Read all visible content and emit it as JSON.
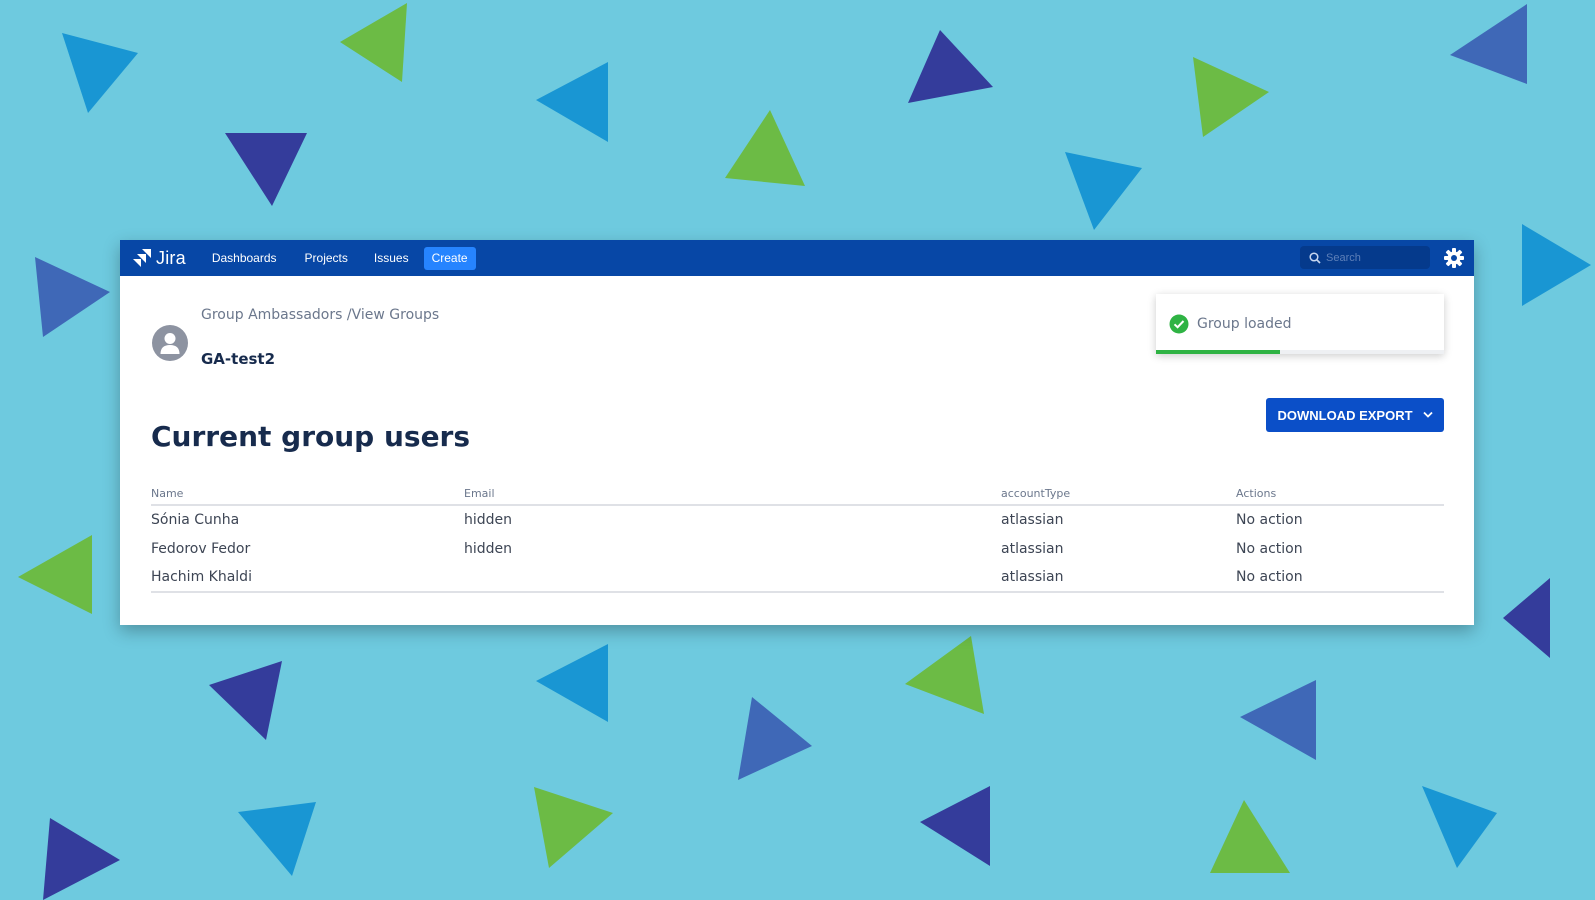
{
  "background": {
    "color": "#6ecadf",
    "triangle_colors": [
      "#1996d3",
      "#6cbb45",
      "#343c9b",
      "#3f68b7"
    ]
  },
  "topbar": {
    "color": "#0747a6",
    "logo_text": "Jira",
    "nav": [
      "Dashboards",
      "Projects",
      "Issues"
    ],
    "create_label": "Create",
    "search_placeholder": "Search",
    "settings_icon": "gear-icon"
  },
  "header": {
    "breadcrumb": {
      "parent": "Group Ambassadors",
      "separator": " /",
      "current": "View Groups"
    },
    "group_name": "GA-test2",
    "avatar_icon": "user-avatar-icon"
  },
  "toast": {
    "message": "Group loaded",
    "icon": "check-circle-icon",
    "progress": 0.43,
    "progress_color": "#2fb344"
  },
  "main": {
    "title": "Current group users",
    "download_label": "DOWNLOAD EXPORT",
    "download_color": "#0b4fc8"
  },
  "table": {
    "columns": [
      "Name",
      "Email",
      "accountType",
      "Actions"
    ],
    "rows": [
      [
        "Sónia Cunha",
        "hidden",
        "atlassian",
        "No action"
      ],
      [
        "Fedorov Fedor",
        "hidden",
        "atlassian",
        "No action"
      ],
      [
        "Hachim Khaldi",
        "",
        "atlassian",
        "No action"
      ]
    ]
  }
}
